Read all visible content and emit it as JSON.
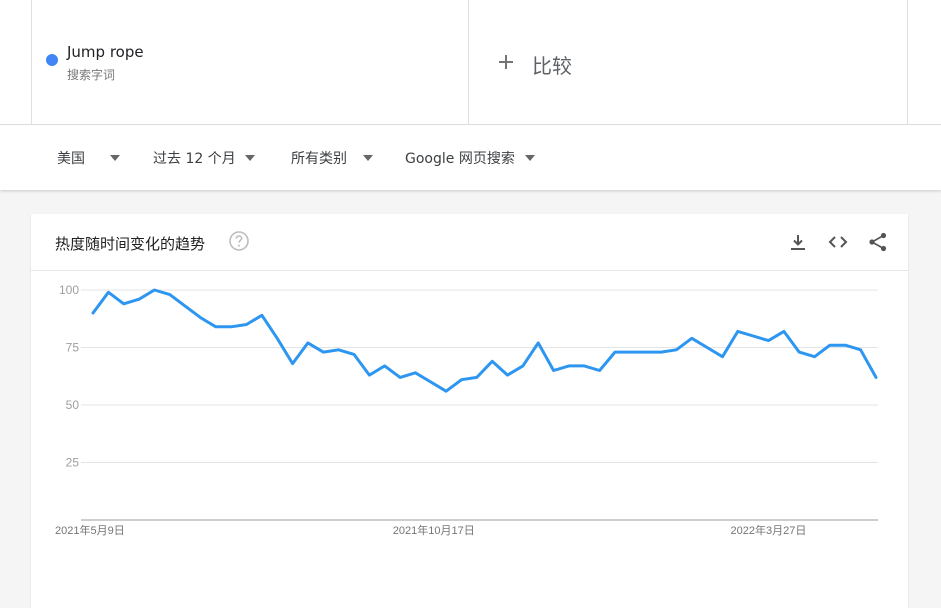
{
  "term": {
    "name": "Jump rope",
    "type": "搜索字词",
    "color": "#4285f4"
  },
  "compare": {
    "label": "比较"
  },
  "filters": [
    {
      "label": "美国"
    },
    {
      "label": "过去 12 个月"
    },
    {
      "label": "所有类别"
    },
    {
      "label": "Google 网页搜索"
    }
  ],
  "panel": {
    "title": "热度随时间变化的趋势"
  },
  "chart_data": {
    "type": "line",
    "title": "",
    "xlabel": "",
    "ylabel": "",
    "ylim": [
      0,
      100
    ],
    "yticks": [
      25,
      50,
      75,
      100
    ],
    "xtick_labels": [
      "2021年5月9日",
      "2021年10月17日",
      "2022年3月27日"
    ],
    "series": [
      {
        "color": "#2d96f0",
        "values": [
          90,
          99,
          94,
          96,
          100,
          98,
          93,
          88,
          84,
          84,
          85,
          89,
          79,
          68,
          77,
          73,
          74,
          72,
          63,
          67,
          62,
          64,
          60,
          56,
          61,
          62,
          69,
          63,
          67,
          77,
          65,
          67,
          67,
          65,
          73,
          73,
          73,
          73,
          74,
          79,
          75,
          71,
          82,
          80,
          78,
          82,
          73,
          71,
          76,
          76,
          74,
          62
        ]
      }
    ]
  }
}
